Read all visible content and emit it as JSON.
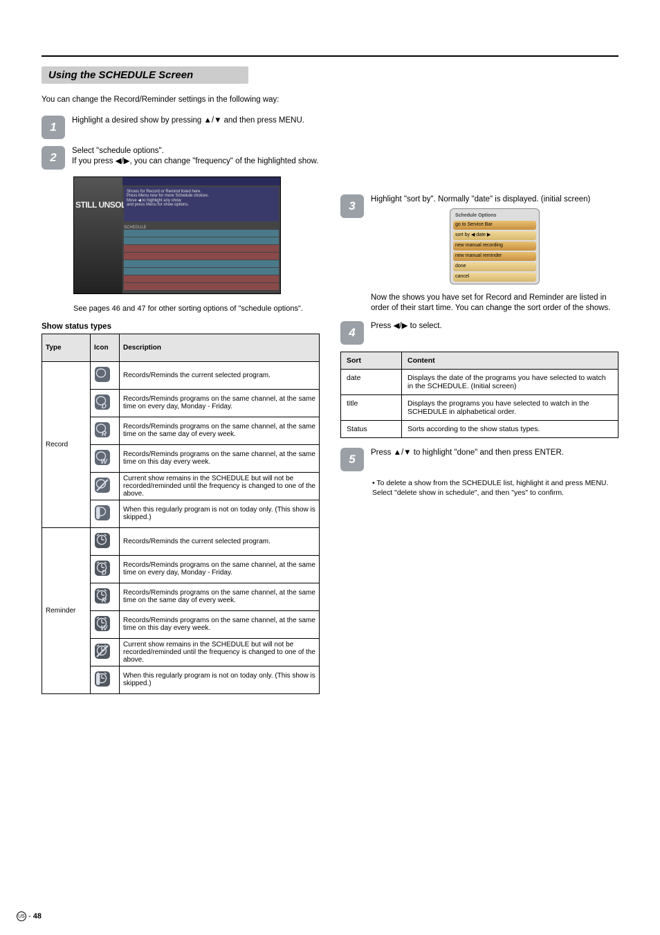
{
  "header": {
    "section_title": "Using the SCHEDULE Screen"
  },
  "col_left": {
    "intro": "You can change the Record/Reminder settings in the following way:",
    "step1": "Highlight a desired show by pressing ▲/▼ and then press MENU.",
    "step2": "Select \"schedule options\".",
    "step2_sub": "If you press ◀/▶, you can change \"frequency\" of the highlighted show.",
    "ref": "See pages 46 and 47 for other sorting options of \"schedule options\".",
    "tbl_title": "Show status types",
    "tbl_head_type": "Type",
    "tbl_head_icon": "Icon",
    "tbl_head_desc": "Description",
    "type_record": "Record",
    "type_reminder": "Reminder",
    "desc_once": "Records/Reminds the current selected program.",
    "desc_daily": "Records/Reminds programs on the same channel, at the same time on every day, Monday - Friday.",
    "desc_regularly": "Records/Reminds programs on the same channel, at the same time on the same day of every week.",
    "desc_weekly": "Records/Reminds programs on the same channel, at the same time on this day every week.",
    "desc_off": "Current show remains in the SCHEDULE but will not be recorded/reminded until the frequency is changed to one of the above.",
    "desc_suspend": "When this regularly program is not on today only. (This show is skipped.)"
  },
  "col_right": {
    "step3a": "Highlight \"sort by\". Normally \"date\" is displayed. (initial screen)",
    "step3b": "Now the shows you have set for Record and Reminder are listed in order of ",
    "step3c": "their start time. You can change the sort order of the shows.",
    "step4": "Press ◀/▶ to select.",
    "tbl_head_sort": "Sort",
    "tbl_head_contents": "Content",
    "sort_items": [
      {
        "key": "date",
        "content": "Displays the date of the programs you have selected to watch in the SCHEDULE. (Initial screen)"
      },
      {
        "key": "title",
        "content": "Displays the programs you have selected to watch in the SCHEDULE in alphabetical order."
      },
      {
        "key": "Status",
        "content": "Sorts according to the show status types."
      }
    ],
    "step5": "Press ▲/▼ to highlight \"done\" and then press ENTER.",
    "note_bullet": "•",
    "note": "To delete a show from the SCHEDULE list, highlight it and press MENU. Select \"delete show in schedule\", and then \"yes\" to confirm."
  },
  "footer": {
    "region": "US",
    "page": "48"
  },
  "thumb_small": {
    "title": "Schedule Options",
    "rows": [
      "go to Service Bar",
      "sort by ◀ date ▶",
      "new manual recording",
      "new manual reminder",
      "done",
      "cancel"
    ]
  }
}
